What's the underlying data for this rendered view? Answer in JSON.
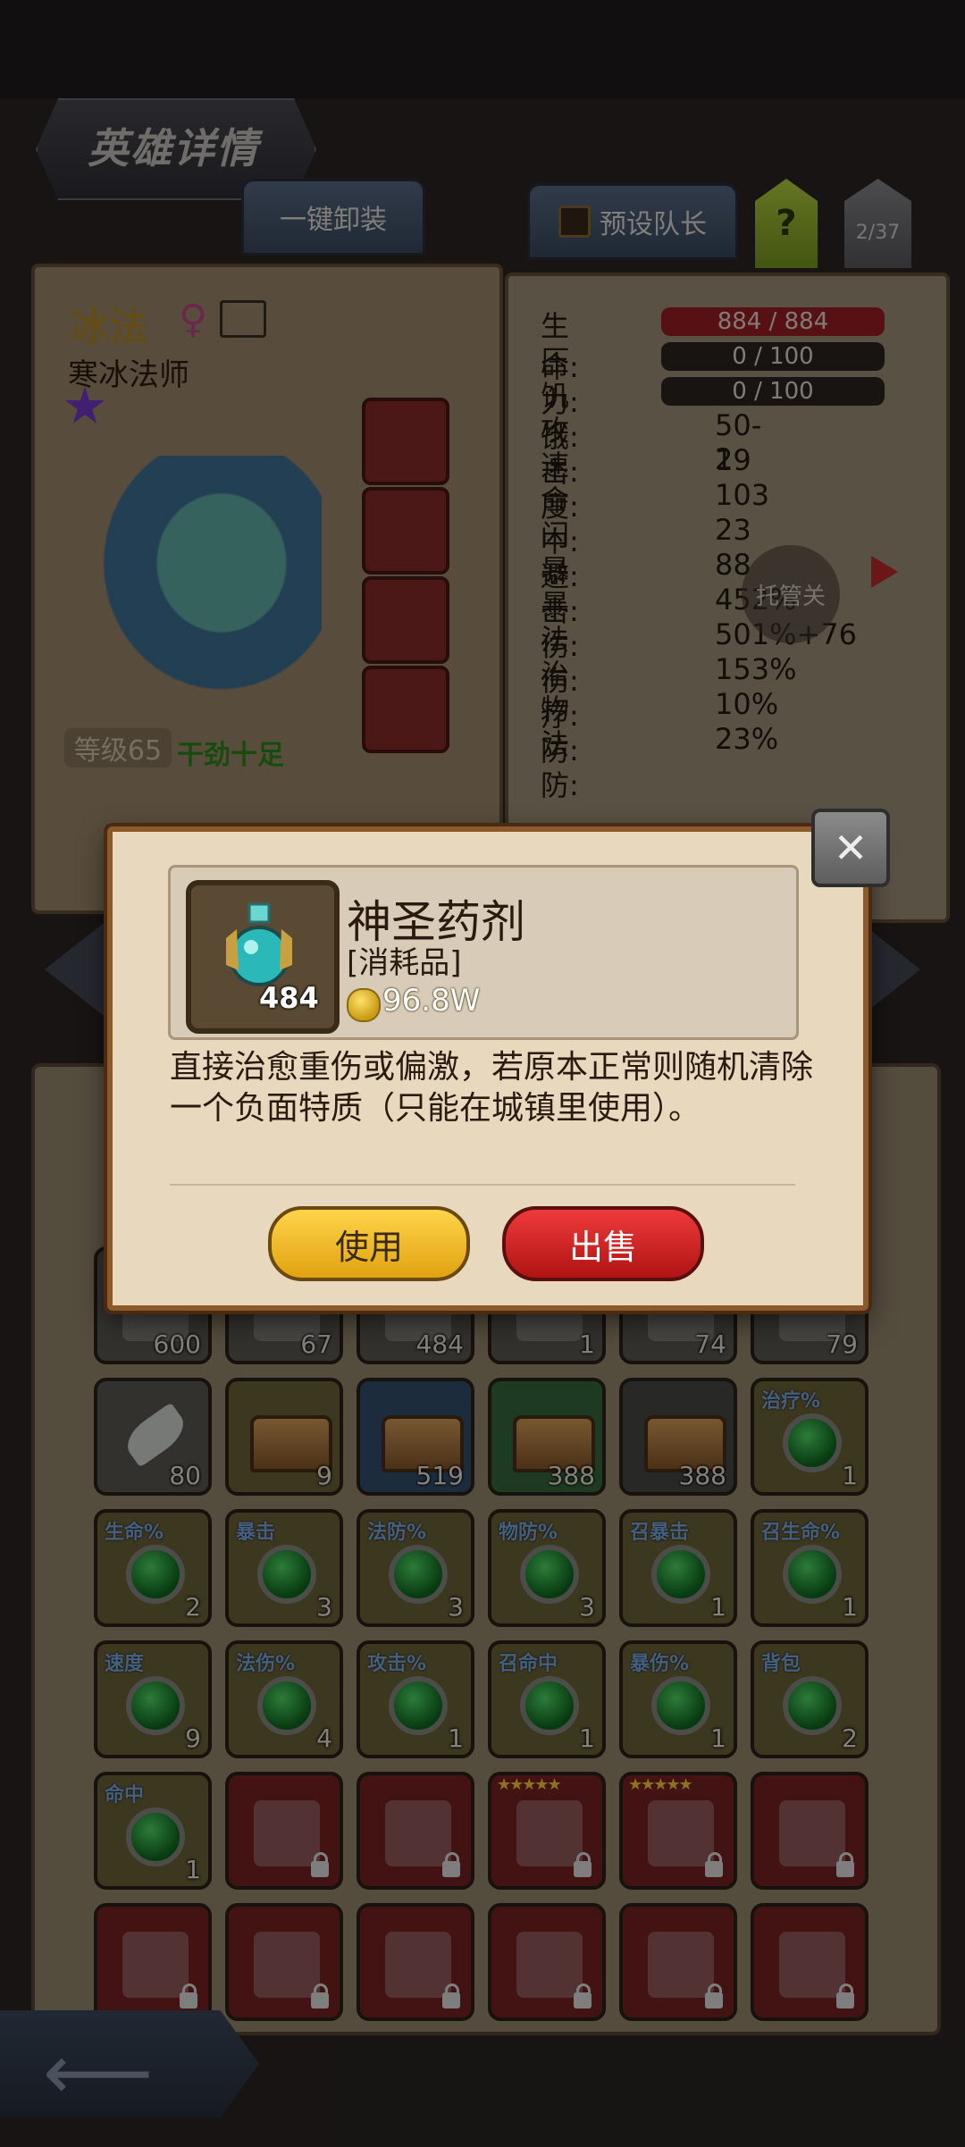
{
  "header": {
    "title": "英雄详情",
    "unequip_all": "一键卸装",
    "preset_captain": "预设队长",
    "help": "?",
    "page_indicator": "2/37"
  },
  "hero": {
    "name": "冰法",
    "gender_symbol": "♀",
    "class_name": "寒冰法师",
    "level": "等级65",
    "mood": "干劲十足",
    "equip_slot_count": 4
  },
  "stats": [
    {
      "label": "生命:",
      "value": "884 / 884",
      "type": "bar-red"
    },
    {
      "label": "压力:",
      "value": "0 / 100",
      "type": "bar-dark"
    },
    {
      "label": "饥饿:",
      "value": "0 / 100",
      "type": "bar-dark"
    },
    {
      "label": "攻击:",
      "value": "50-2",
      "type": "text"
    },
    {
      "label": "速度:",
      "value": "19",
      "type": "text"
    },
    {
      "label": "命中:",
      "value": "103",
      "type": "text"
    },
    {
      "label": "闪避:",
      "value": "23",
      "type": "text"
    },
    {
      "label": "暴击:",
      "value": "88",
      "type": "text"
    },
    {
      "label": "暴伤:",
      "value": "452%",
      "type": "text"
    },
    {
      "label": "法伤:",
      "value": "501%+76",
      "type": "text"
    },
    {
      "label": "治疗:",
      "value": "153%",
      "type": "text"
    },
    {
      "label": "物防:",
      "value": "10%",
      "type": "text"
    },
    {
      "label": "法防:",
      "value": "23%",
      "type": "text"
    }
  ],
  "auto_button": "托管关",
  "inventory": {
    "rows": [
      [
        {
          "count": "600",
          "style": "s-gray",
          "kind": "item"
        },
        {
          "count": "67",
          "style": "s-gray",
          "kind": "item"
        },
        {
          "count": "484",
          "style": "s-gray",
          "kind": "item"
        },
        {
          "count": "1",
          "style": "s-gray",
          "kind": "item"
        },
        {
          "count": "74",
          "style": "s-gray",
          "kind": "item"
        },
        {
          "count": "79",
          "style": "s-gray",
          "kind": "item"
        }
      ],
      [
        {
          "count": "80",
          "style": "s-gray",
          "kind": "feather"
        },
        {
          "count": "9",
          "style": "s-olive",
          "kind": "chest"
        },
        {
          "count": "519",
          "style": "s-blue",
          "kind": "chest"
        },
        {
          "count": "388",
          "style": "s-green",
          "kind": "chest"
        },
        {
          "count": "388",
          "style": "s-dgray",
          "kind": "chest"
        },
        {
          "count": "1",
          "style": "s-olive",
          "kind": "gem",
          "tag": "治疗%"
        }
      ],
      [
        {
          "count": "2",
          "style": "s-olive",
          "kind": "gem",
          "tag": "生命%"
        },
        {
          "count": "3",
          "style": "s-olive",
          "kind": "gem",
          "tag": "暴击"
        },
        {
          "count": "3",
          "style": "s-olive",
          "kind": "gem",
          "tag": "法防%"
        },
        {
          "count": "3",
          "style": "s-olive",
          "kind": "gem",
          "tag": "物防%"
        },
        {
          "count": "1",
          "style": "s-olive",
          "kind": "gem",
          "tag": "召暴击"
        },
        {
          "count": "1",
          "style": "s-olive",
          "kind": "gem",
          "tag": "召生命%"
        }
      ],
      [
        {
          "count": "9",
          "style": "s-olive",
          "kind": "gem",
          "tag": "速度"
        },
        {
          "count": "4",
          "style": "s-olive",
          "kind": "gem",
          "tag": "法伤%"
        },
        {
          "count": "1",
          "style": "s-olive",
          "kind": "gem",
          "tag": "攻击%"
        },
        {
          "count": "1",
          "style": "s-olive",
          "kind": "gem",
          "tag": "召命中"
        },
        {
          "count": "1",
          "style": "s-olive",
          "kind": "gem",
          "tag": "暴伤%"
        },
        {
          "count": "2",
          "style": "s-olive",
          "kind": "gem",
          "tag": "背包"
        }
      ],
      [
        {
          "count": "1",
          "style": "s-olive",
          "kind": "gem",
          "tag": "命中"
        },
        {
          "count": "",
          "style": "s-red",
          "kind": "locked"
        },
        {
          "count": "",
          "style": "s-red",
          "kind": "locked"
        },
        {
          "count": "",
          "style": "s-red",
          "kind": "locked",
          "stars": "★★★★★"
        },
        {
          "count": "",
          "style": "s-red",
          "kind": "locked",
          "stars": "★★★★★"
        },
        {
          "count": "",
          "style": "s-red",
          "kind": "locked"
        }
      ],
      [
        {
          "count": "",
          "style": "s-red",
          "kind": "locked"
        },
        {
          "count": "",
          "style": "s-red",
          "kind": "locked"
        },
        {
          "count": "",
          "style": "s-red",
          "kind": "locked"
        },
        {
          "count": "",
          "style": "s-red",
          "kind": "locked"
        },
        {
          "count": "",
          "style": "s-red",
          "kind": "locked"
        },
        {
          "count": "",
          "style": "s-red",
          "kind": "locked"
        }
      ]
    ]
  },
  "modal": {
    "item_name": "神圣药剂",
    "item_type": "[消耗品]",
    "item_count": "484",
    "price": "96.8W",
    "description": "直接治愈重伤或偏激，若原本正常则随机清除一个负面特质（只能在城镇里使用）。",
    "use_label": "使用",
    "sell_label": "出售",
    "close_icon": "close-icon"
  },
  "colors": {
    "modal_bg": "#e8d8bd",
    "use_button": "#f5b820",
    "sell_button": "#d82020",
    "hp_bar": "#9e1e26"
  }
}
